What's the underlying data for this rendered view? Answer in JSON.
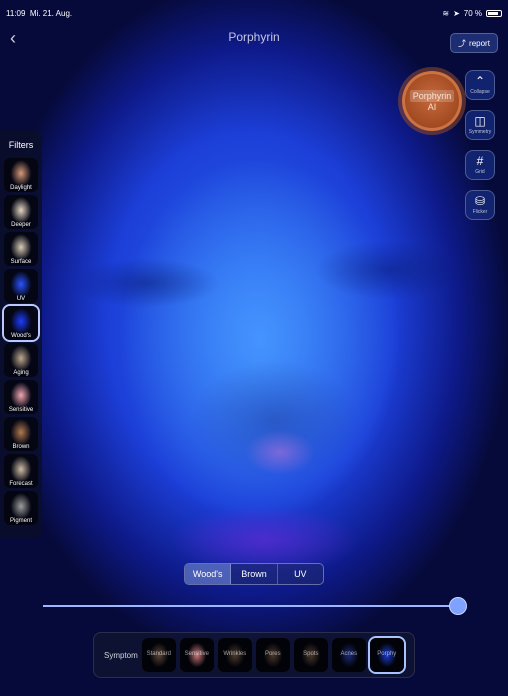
{
  "status_bar": {
    "time": "11:09",
    "date": "Mi. 21. Aug.",
    "battery": "70 %"
  },
  "nav": {
    "back_label": "‹",
    "title": "Porphyrin",
    "report_label": "report"
  },
  "ai_badge": {
    "line1": "Porphyrin",
    "line2": "AI"
  },
  "tools": [
    {
      "label": "Collapse",
      "icon": "chevron-up-icon"
    },
    {
      "label": "Symmetry",
      "icon": "split-square-icon"
    },
    {
      "label": "Grid",
      "icon": "grid-icon"
    },
    {
      "label": "Flicker",
      "icon": "flicker-icon"
    }
  ],
  "filters": {
    "header": "Filters",
    "items": [
      {
        "label": "Daylight",
        "color": "#d69a7a"
      },
      {
        "label": "Deeper",
        "color": "#e6d6c2"
      },
      {
        "label": "Surface",
        "color": "#d9ccb6"
      },
      {
        "label": "UV",
        "color": "#2a54ff"
      },
      {
        "label": "Wood's",
        "color": "#1f3dff",
        "active": true
      },
      {
        "label": "Aging",
        "color": "#bda98f"
      },
      {
        "label": "Sensitive",
        "color": "#f2a8b2"
      },
      {
        "label": "Brown",
        "color": "#b37a4f"
      },
      {
        "label": "Forecast",
        "color": "#cfbda6"
      },
      {
        "label": "Pigment",
        "color": "#9e9e9e"
      }
    ]
  },
  "segment": {
    "options": [
      "Wood's",
      "Brown",
      "UV"
    ],
    "active_index": 0
  },
  "slider": {
    "value": 1.0
  },
  "symptom": {
    "header": "Symptom",
    "items": [
      {
        "label": "Standard",
        "color": "#5a4537"
      },
      {
        "label": "Sensitive",
        "color": "#c9787a"
      },
      {
        "label": "Wrinkles",
        "color": "#4d3b2e"
      },
      {
        "label": "Pores",
        "color": "#4a382c"
      },
      {
        "label": "Spots",
        "color": "#4a382c"
      },
      {
        "label": "Acnes",
        "color": "#1b2a7a"
      },
      {
        "label": "Porphy",
        "color": "#1b3dd0",
        "active": true
      }
    ]
  }
}
